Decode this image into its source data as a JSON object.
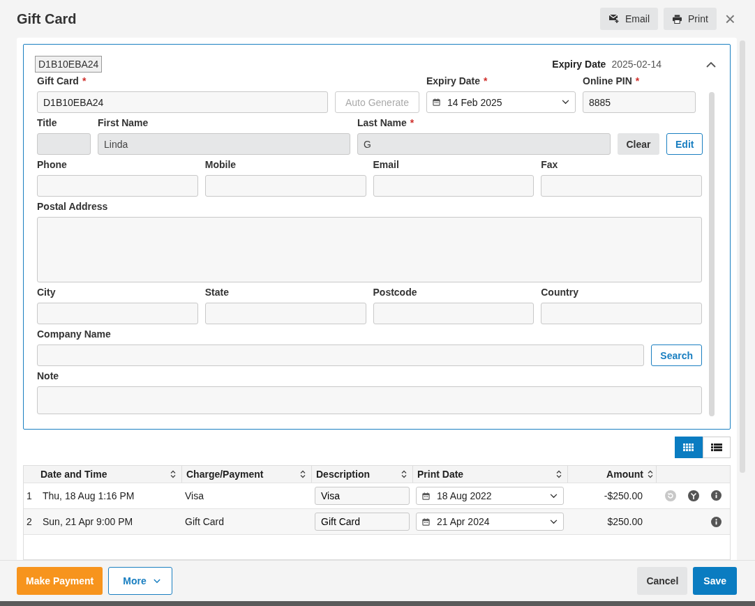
{
  "window": {
    "title": "Gift Card",
    "actions": [
      {
        "label": "Email",
        "kind": "email"
      },
      {
        "label": "Print",
        "kind": "print"
      }
    ],
    "close": "×"
  },
  "summary": {
    "code": "D1B10EBA24",
    "expiry_label": "Expiry Date",
    "expiry_value": "2025-02-14",
    "expanded": true
  },
  "form": {
    "lines": [
      {
        "fields": [
          {
            "kind": "input",
            "label": "Gift Card",
            "required_mark": "*",
            "value": "D1B10EBA24",
            "disabled": false
          },
          {
            "kind": "generate",
            "label": "Auto Generate",
            "disabled": true
          },
          {
            "kind": "date",
            "label": "Expiry Date",
            "required_mark": "*",
            "value": "14 Feb 2025"
          },
          {
            "kind": "input",
            "label": "Online PIN",
            "required_mark": "*",
            "value": "8885",
            "disabled": false
          }
        ]
      },
      {
        "fields": [
          {
            "kind": "input",
            "label": "Title",
            "disabled": true
          },
          {
            "kind": "input",
            "label": "First Name",
            "value": "Linda",
            "disabled": true
          },
          {
            "kind": "input",
            "label": "Last Name",
            "required_mark": "*",
            "value": "G",
            "disabled": true
          },
          {
            "kind": "clear",
            "label": "Clear",
            "disabled": false
          },
          {
            "kind": "edit",
            "label": "Edit",
            "disabled": false
          }
        ]
      },
      {
        "fields": [
          {
            "kind": "input",
            "label": "Phone",
            "disabled": false
          },
          {
            "kind": "input",
            "label": "Mobile",
            "disabled": false
          },
          {
            "kind": "input",
            "label": "Email",
            "disabled": false
          },
          {
            "kind": "input",
            "label": "Fax",
            "disabled": false
          }
        ]
      },
      {
        "fields": [
          {
            "kind": "textarea",
            "label": "Postal Address"
          }
        ]
      },
      {
        "fields": [
          {
            "kind": "input",
            "label": "City",
            "disabled": false
          },
          {
            "kind": "input",
            "label": "State",
            "disabled": false
          },
          {
            "kind": "input",
            "label": "Postcode",
            "disabled": false
          },
          {
            "kind": "input",
            "label": "Country",
            "disabled": false
          }
        ]
      },
      {
        "fields": [
          {
            "kind": "input",
            "label": "Company Name",
            "disabled": false
          },
          {
            "kind": "search",
            "label": "Search",
            "disabled": false
          }
        ]
      },
      {
        "fields": [
          {
            "kind": "note",
            "label": "Note"
          }
        ]
      }
    ]
  },
  "view_toggle": [
    {
      "kind": "grid",
      "selected": true
    },
    {
      "kind": "list",
      "selected": false
    }
  ],
  "table": {
    "columns": [
      "Date and Time",
      "Charge/Payment",
      "Description",
      "Print Date",
      "Amount"
    ],
    "rows": [
      {
        "index": "1",
        "date_time": "Thu, 18 Aug 1:16 PM",
        "charge_payment": "Visa",
        "description": "Visa",
        "print_date": "18 Aug 2022",
        "amount": "-$250.00",
        "actions": [
          {
            "kind": "undo",
            "disabled": true
          },
          {
            "kind": "split",
            "disabled": false
          },
          {
            "kind": "info",
            "disabled": false
          }
        ]
      },
      {
        "index": "2",
        "date_time": "Sun, 21 Apr 9:00 PM",
        "charge_payment": "Gift Card",
        "description": "Gift Card",
        "print_date": "21 Apr 2024",
        "amount": "$250.00",
        "actions": [
          {
            "kind": "info",
            "disabled": false
          }
        ]
      }
    ]
  },
  "footer": {
    "left": [
      {
        "label": "Make Payment",
        "kind": "primary-orange"
      },
      {
        "label": "More",
        "kind": "menu"
      }
    ],
    "right": [
      {
        "label": "Cancel",
        "kind": "grey"
      },
      {
        "label": "Save",
        "kind": "primary"
      }
    ]
  }
}
